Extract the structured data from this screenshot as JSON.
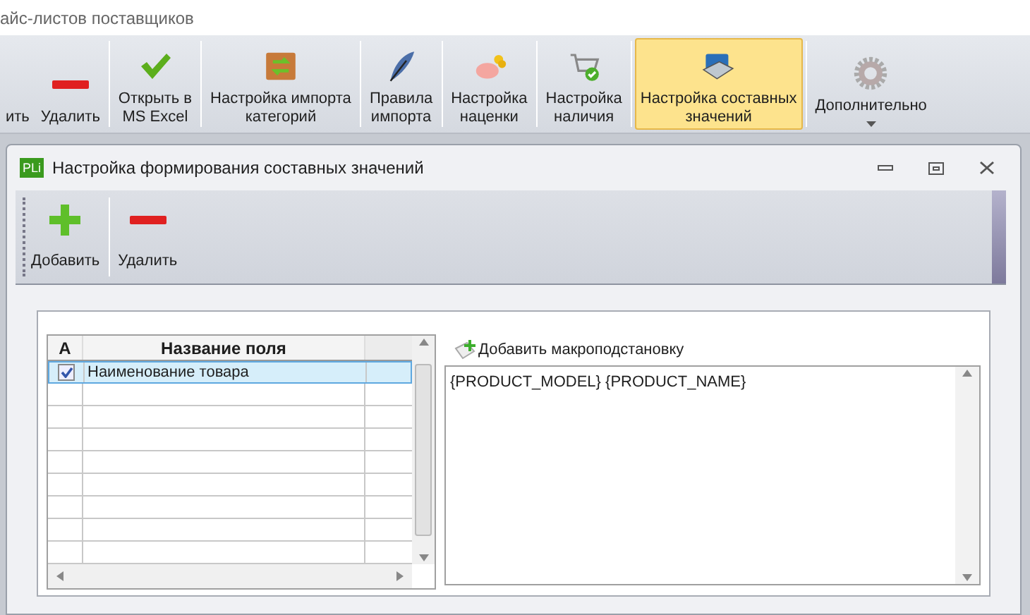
{
  "app_title": "айс-листов поставщиков",
  "ribbon": {
    "buttons": [
      {
        "label": "ить",
        "selected": false
      },
      {
        "label": "Удалить",
        "kind": "minus",
        "selected": false
      },
      {
        "label": "Открыть в\nMS Excel",
        "kind": "check",
        "selected": false
      },
      {
        "label": "Настройка импорта\nкатегорий",
        "kind": "box",
        "selected": false
      },
      {
        "label": "Правила\nимпорта",
        "kind": "quill",
        "selected": false
      },
      {
        "label": "Настройка\nнаценки",
        "kind": "piggy",
        "selected": false
      },
      {
        "label": "Настройка\nналичия",
        "kind": "cart",
        "selected": false
      },
      {
        "label": "Настройка составных\nзначений",
        "kind": "panel",
        "selected": true
      },
      {
        "label": "Дополнительно",
        "kind": "gear",
        "selected": false,
        "dropdown": true
      }
    ]
  },
  "dialog": {
    "title": "Настройка формирования составных значений",
    "logo": "PLi",
    "toolbar": [
      {
        "label": "Добавить",
        "kind": "plus"
      },
      {
        "label": "Удалить",
        "kind": "minus"
      }
    ],
    "grid": {
      "columns": [
        "A",
        "Название поля"
      ],
      "rows": [
        {
          "checked": true,
          "name": "Наименование товара",
          "selected": true
        }
      ]
    },
    "macro_link": "Добавить макроподстановку",
    "formula": "{PRODUCT_MODEL} {PRODUCT_NAME}"
  }
}
